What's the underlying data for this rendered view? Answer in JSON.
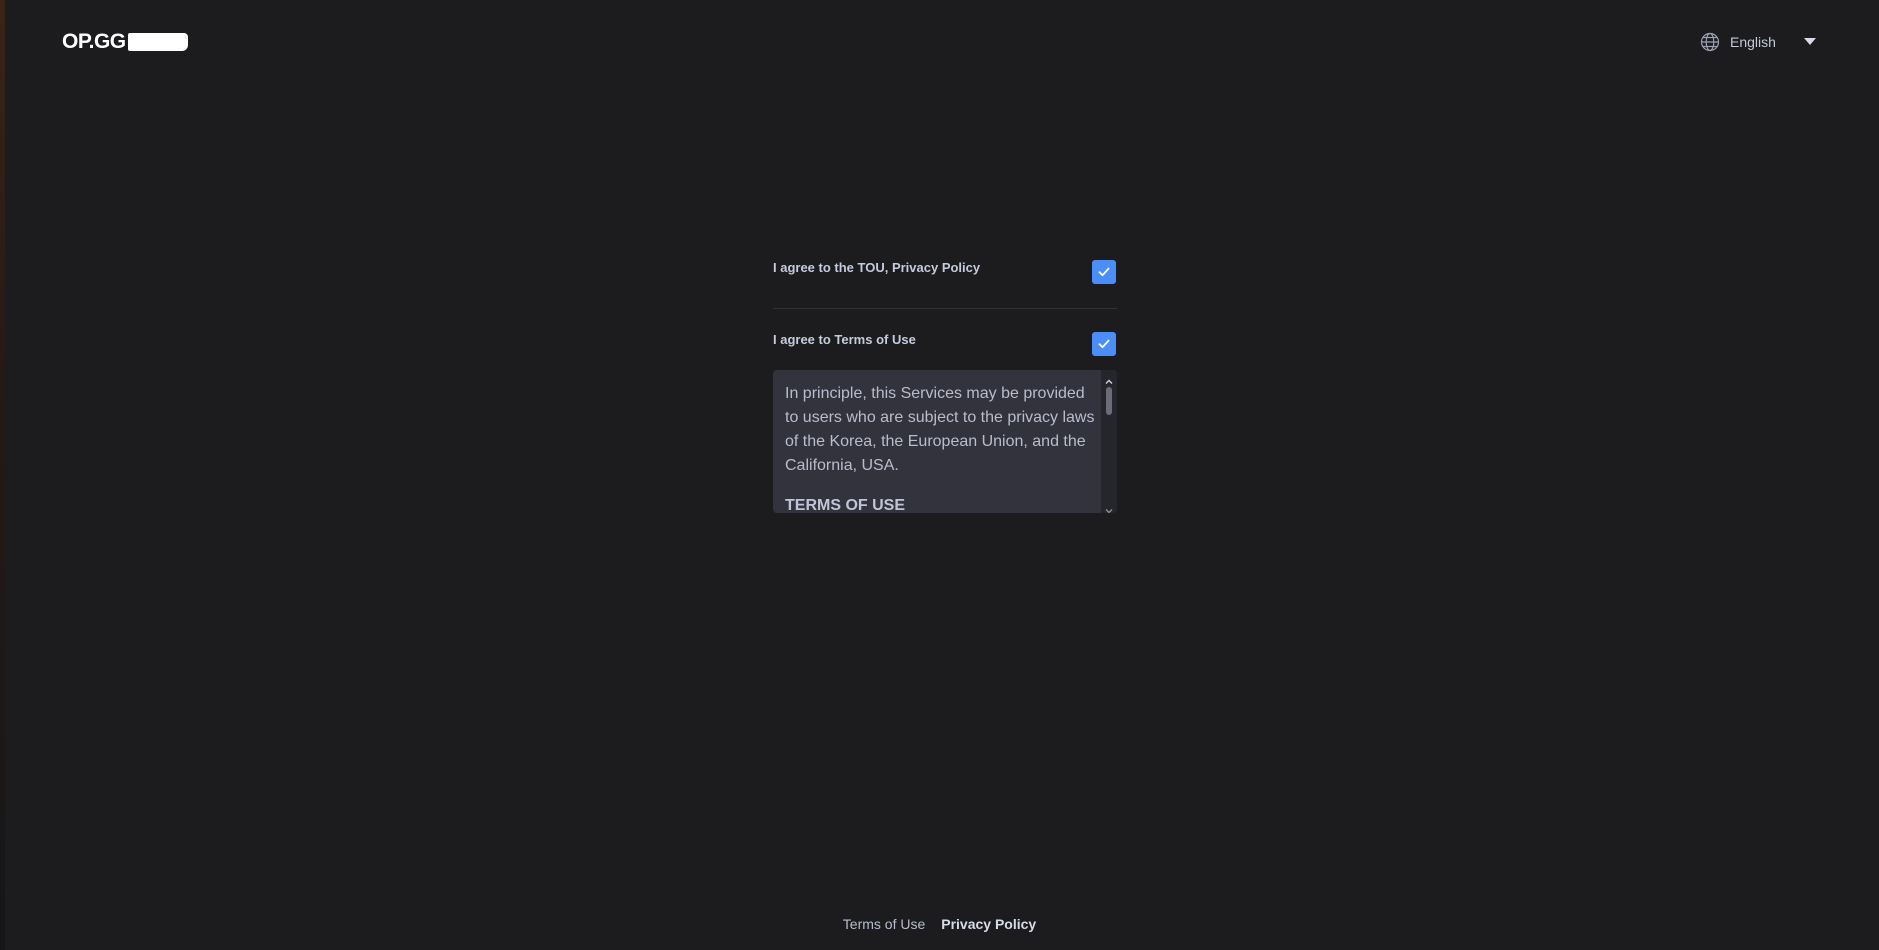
{
  "header": {
    "logo_text": "OP.GG",
    "language": {
      "icon": "globe-icon",
      "selected": "English",
      "dropdown_icon": "caret-down-icon"
    }
  },
  "agreements": [
    {
      "label": "I agree to the TOU, Privacy Policy",
      "checked": true
    },
    {
      "label": "I agree to Terms of Use",
      "checked": true
    }
  ],
  "terms_box": {
    "paragraph": "In principle, this Services may be provided to users who are subject to the privacy laws of the Korea, the European Union, and the California, USA.",
    "heading": "TERMS OF USE"
  },
  "footer": {
    "terms_link": "Terms of Use",
    "privacy_link": "Privacy Policy"
  },
  "colors": {
    "background": "#1c1c1f",
    "checkbox": "#4c8ef7",
    "terms_box": "#33333d"
  }
}
